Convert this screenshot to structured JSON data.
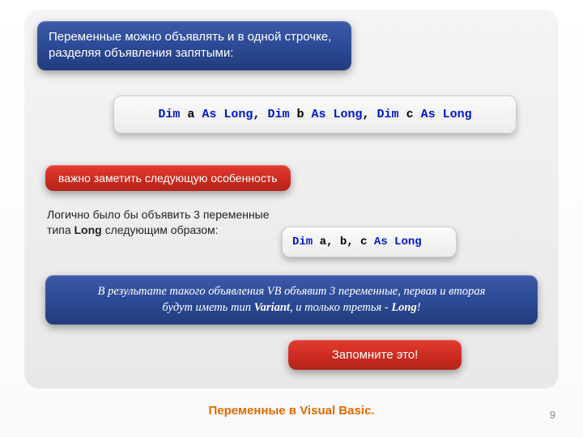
{
  "title": "Переменные можно объявлять и в одной строчке, разделяя объявления запятыми:",
  "code1": {
    "dim1": "Dim",
    "a": "a",
    "as1": "As Long",
    "sep1": ", ",
    "dim2": "Dim",
    "b": "b",
    "as2": "As Long",
    "sep2": ", ",
    "dim3": "Dim",
    "c": "c",
    "as3": "As Long"
  },
  "note1": "важно заметить следующую особенность",
  "para_prefix": "Логично было бы объявить 3 переменные типа ",
  "para_bold": "Long",
  "para_suffix": " следующим образом:",
  "code2": {
    "dim": "Dim",
    "vars": "a, b, c",
    "as": "As Long"
  },
  "result_l1": "В результате такого объявления VB объявит 3 переменные, первая и вторая",
  "result_l2_a": "будут иметь тип ",
  "result_l2_b": "Variant",
  "result_l2_c": ", и только третья - ",
  "result_l2_d": "Long",
  "result_l2_e": "!",
  "note2": "Запомните это!",
  "footer": "Переменные в Visual Basic.",
  "page": "9"
}
